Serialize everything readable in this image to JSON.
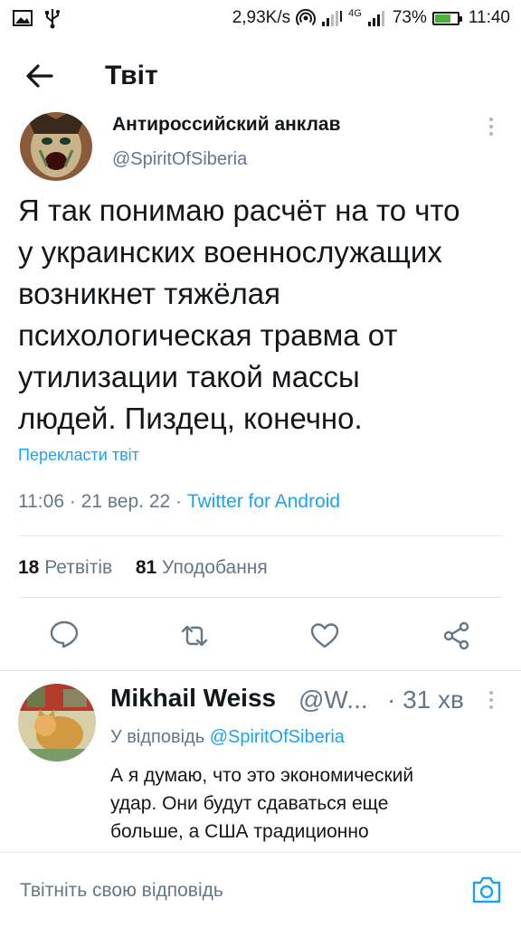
{
  "status_bar": {
    "speed": "2,93K/s",
    "network": "4G",
    "battery_pct": "73%",
    "battery_level": 0.73,
    "time": "11:40",
    "icons": [
      "image-icon",
      "usb-icon",
      "hotspot-icon",
      "signal-icon",
      "signal-4g-icon",
      "battery-icon"
    ]
  },
  "header": {
    "title": "Твіт",
    "back_icon": "arrow-left-icon"
  },
  "tweet": {
    "author_name": "Антироссийский анклав",
    "author_handle": "@SpiritOfSiberia",
    "text_lines": [
      "Я так понимаю расчёт на то что",
      "у украинских военнослужащих",
      "возникнет тяжёлая",
      "психологическая травма от",
      "утилизации такой массы",
      "людей. Пиздец, конечно."
    ],
    "translate_label": "Перекласти твіт",
    "time": "11:06",
    "date": "21 вер. 22",
    "client": "Twitter for Android",
    "retweets_count": "18",
    "retweets_label": "Ретвітів",
    "likes_count": "81",
    "likes_label": "Уподобання",
    "actions": [
      "reply-icon",
      "retweet-icon",
      "like-icon",
      "share-icon"
    ]
  },
  "reply": {
    "author_name": "Mikhail Weiss",
    "author_handle": "@W...",
    "time": "· 31 хв",
    "reply_to_prefix": "У відповідь",
    "reply_to_handle": "@SpiritOfSiberia",
    "text_lines": [
      "А я думаю, что это экономический",
      "удар. Они будут сдаваться еще",
      "больше, а США традиционно"
    ]
  },
  "compose": {
    "placeholder": "Твітніть свою відповідь",
    "camera_icon": "camera-icon"
  },
  "colors": {
    "accent": "#1da1f2",
    "text_primary": "#14171a",
    "text_secondary": "#657786",
    "divider": "#e1e8ed",
    "battery_green": "#4caf3d"
  }
}
